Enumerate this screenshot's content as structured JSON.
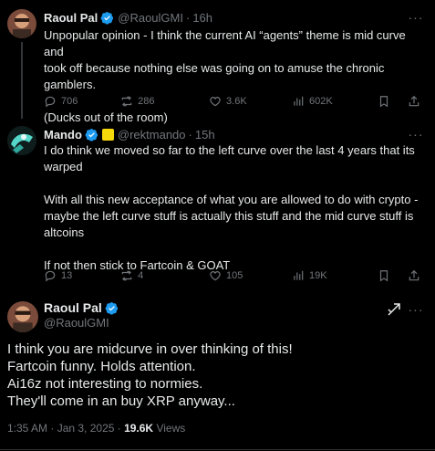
{
  "colors": {
    "background": "#000000",
    "text": "#e7e9ea",
    "muted": "#71767b",
    "verified": "#1d9bf0"
  },
  "post1": {
    "name": "Raoul Pal",
    "handle": "@RaoulGMI",
    "time": "16h",
    "text": "Unpopular opinion - I think the current AI “agents” theme is mid curve and\ntook off because nothing else was going on to amuse the chronic gamblers.\n\n(Ducks out of the room)",
    "replies": "706",
    "reposts": "286",
    "likes": "3.6K",
    "views": "602K"
  },
  "post2": {
    "name": "Mando",
    "handle": "@rektmando",
    "time": "15h",
    "text": "I do think we moved so far to the left curve over the last 4 years that its\nwarped\n\nWith all this new acceptance of what you are allowed to do with crypto -\nmaybe the left curve stuff is actually this stuff and the mid curve stuff is\naltcoins\n\nIf not then stick to Fartcoin & GOAT",
    "replies": "13",
    "reposts": "4",
    "likes": "105",
    "views": "19K"
  },
  "post3": {
    "name": "Raoul Pal",
    "handle": "@RaoulGMI",
    "text": "I think you are midcurve in over thinking of this!\nFartcoin funny. Holds attention.\nAi16z not interesting to normies.\nThey'll come in an buy XRP anyway...",
    "timestamp": "1:35 AM · Jan 3, 2025 · ",
    "views_count": "19.6K",
    "views_label": " Views"
  },
  "icons": [
    "verified-badge-icon",
    "more-icon",
    "reply-icon",
    "repost-icon",
    "like-icon",
    "views-icon",
    "bookmark-icon",
    "share-icon",
    "grok-icon"
  ]
}
